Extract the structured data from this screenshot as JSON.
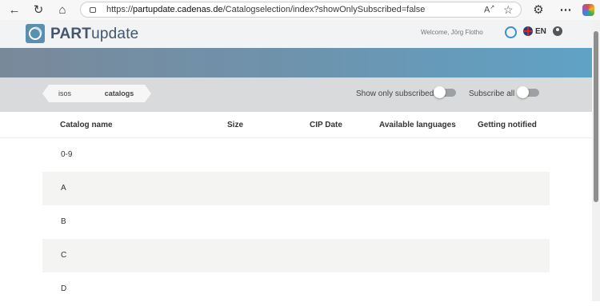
{
  "browser": {
    "url_scheme": "https://",
    "url_host": "partupdate.cadenas.de",
    "url_path": "/Catalogselection/index?showOnlySubscribed=false"
  },
  "header": {
    "logo_bold": "PART",
    "logo_light": "update",
    "welcome": "Welcome, Jörg Flotho",
    "language": "EN"
  },
  "toolbar": {
    "breadcrumbs": [
      "isos",
      "catalogs"
    ],
    "show_only_subscribed_label": "Show only subscribed",
    "subscribe_all_label": "Subscribe all"
  },
  "table": {
    "columns": [
      "Catalog name",
      "Size",
      "CIP Date",
      "Available languages",
      "Getting notified"
    ],
    "rows": [
      "0-9",
      "A",
      "B",
      "C",
      "D"
    ]
  },
  "colors": {
    "banner_start": "#79899a",
    "banner_end": "#5fa2c6",
    "toolbar_bg": "#d9dadb"
  }
}
